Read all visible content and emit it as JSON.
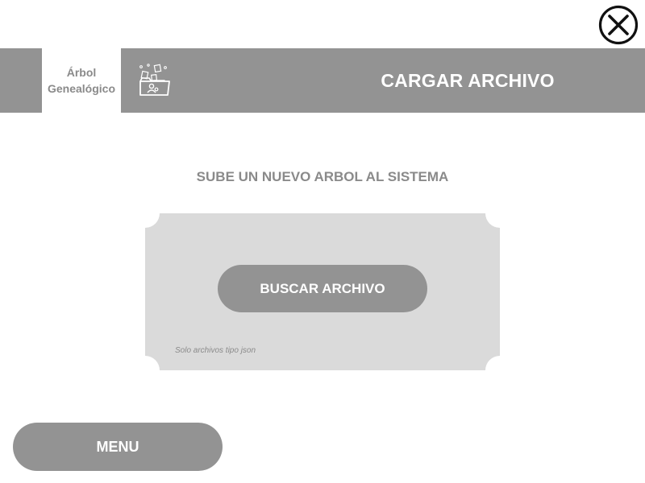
{
  "header": {
    "logo_line1": "Árbol",
    "logo_line2": "Genealógico",
    "title": "CARGAR ARCHIVO",
    "upload_icon": "folder-upload-icon"
  },
  "window": {
    "close_icon": "close-icon"
  },
  "main": {
    "subtitle": "SUBE UN NUEVO ARBOL AL SISTEMA",
    "browse_button_label": "BUSCAR ARCHIVO",
    "hint": "Solo archivos tipo json"
  },
  "footer": {
    "menu_button_label": "MENU"
  },
  "colors": {
    "bar": "#939393",
    "panel": "#dadada",
    "muted_text": "#8a8a8a",
    "white": "#ffffff",
    "close_stroke": "#111111"
  }
}
